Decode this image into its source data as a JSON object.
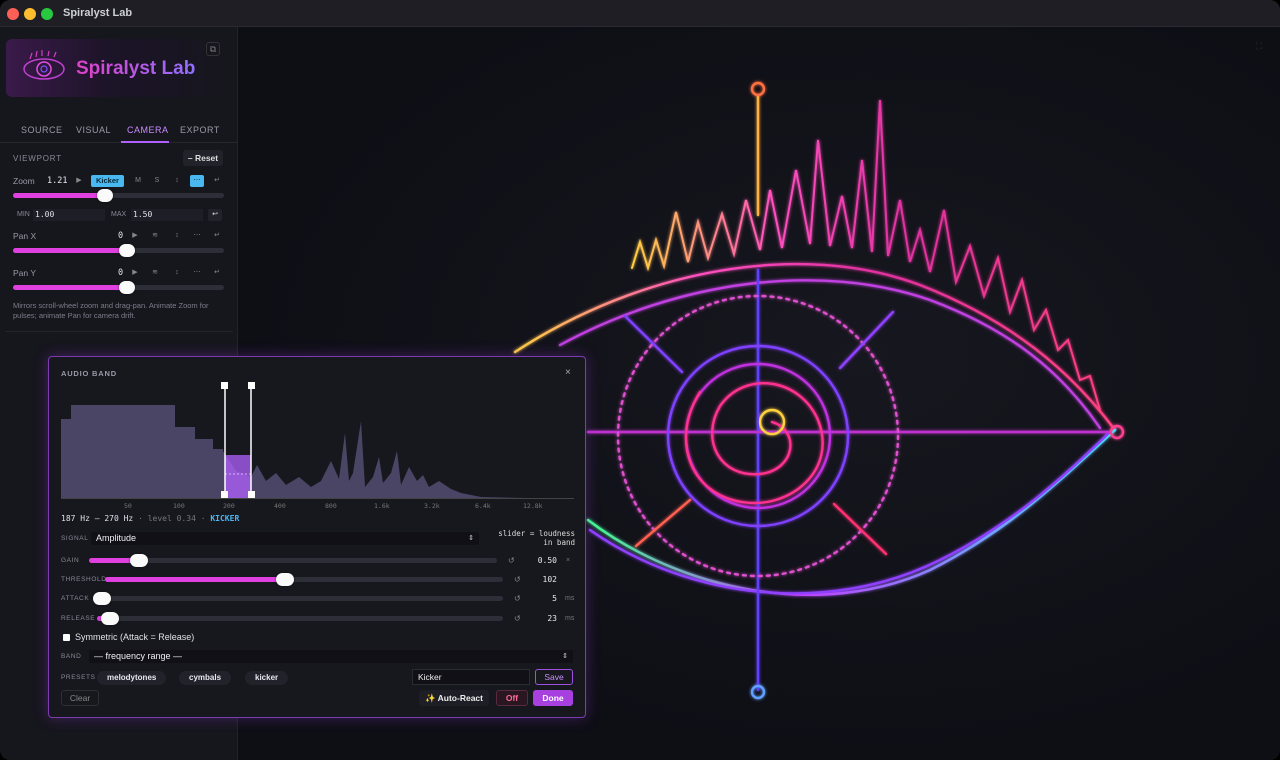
{
  "window": {
    "title": "Spiralyst Lab"
  },
  "brand": {
    "title": "Spiralyst Lab",
    "logo_icon": "spiral-eye-logo-icon"
  },
  "colors": {
    "accent": "#e040e0",
    "tab_active": "#c98cff",
    "chip": "#4ab8f0",
    "done": "#a840e0",
    "off": "#ff6a9a"
  },
  "tabs": [
    {
      "label": "SOURCE"
    },
    {
      "label": "VISUAL"
    },
    {
      "label": "CAMERA",
      "active": true
    },
    {
      "label": "EXPORT"
    }
  ],
  "viewport": {
    "section": "VIEWPORT",
    "reset_label": "– Reset",
    "zoom": {
      "label": "Zoom",
      "value": "1.21",
      "chip": "Kicker",
      "m": "M",
      "s": "S",
      "level": 0.4
    },
    "min_label": "MIN",
    "min_value": "1.00",
    "max_label": "MAX",
    "max_value": "1.50",
    "pan_x": {
      "label": "Pan X",
      "value": "0",
      "level": 0.5
    },
    "pan_y": {
      "label": "Pan Y",
      "value": "0",
      "level": 0.5
    },
    "help": "Mirrors scroll-wheel zoom and drag-pan. Animate Zoom for pulses; animate Pan for camera drift."
  },
  "audio_band": {
    "title": "AUDIO BAND",
    "close": "×",
    "freq_ticks": [
      "50",
      "100",
      "200",
      "400",
      "800",
      "1.6k",
      "3.2k",
      "6.4k",
      "12.8k"
    ],
    "range": "187 Hz – 270 Hz",
    "level": "level 0.34",
    "tag": "KICKER",
    "signal_label": "SIGNAL",
    "signal_value": "Amplitude",
    "note": "slider = loudness in band",
    "gain": {
      "label": "GAIN",
      "value": "0.50",
      "unit": "×",
      "level": 0.1
    },
    "threshold": {
      "label": "THRESHOLD",
      "value": "102",
      "unit": "",
      "level": 0.43
    },
    "attack": {
      "label": "ATTACK",
      "value": "5",
      "unit": "ms",
      "level": 0.0
    },
    "release": {
      "label": "RELEASE",
      "value": "23",
      "unit": "ms",
      "level": 0.01
    },
    "symmetric_label": "Symmetric (Attack = Release)",
    "band_label": "BAND",
    "band_value": "— frequency range —",
    "presets_label": "PRESETS",
    "presets": [
      "melodytones",
      "cymbals",
      "kicker"
    ],
    "preset_name": "Kicker",
    "save_label": "Save",
    "clear_label": "Clear",
    "auto_react_label": "✨ Auto-React",
    "off_label": "Off",
    "done_label": "Done"
  }
}
